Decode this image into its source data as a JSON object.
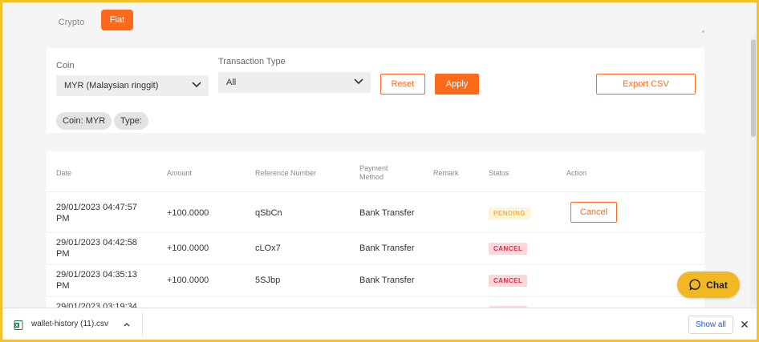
{
  "tabs": {
    "crypto": "Crypto",
    "fiat": "Fiat"
  },
  "filters": {
    "coin_label": "Coin",
    "coin_value": "MYR (Malaysian ringgit)",
    "type_label": "Transaction Type",
    "type_value": "All",
    "reset_label": "Reset",
    "apply_label": "Apply",
    "export_label": "Export CSV",
    "chip_coin": "Coin: MYR",
    "chip_type": "Type:"
  },
  "table": {
    "headers": {
      "date": "Date",
      "amount": "Amount",
      "reference": "Reference Number",
      "payment_1": "Payment",
      "payment_2": "Method",
      "remark": "Remark",
      "status": "Status",
      "action": "Action"
    },
    "rows": [
      {
        "date_1": "29/01/2023 04:47:57",
        "date_2": "PM",
        "amount": "+100.0000",
        "reference": "qSbCn",
        "method": "Bank Transfer",
        "status": "PENDING",
        "action": "Cancel"
      },
      {
        "date_1": "29/01/2023 04:42:58",
        "date_2": "PM",
        "amount": "+100.0000",
        "reference": "cLOx7",
        "method": "Bank Transfer",
        "status": "CANCEL"
      },
      {
        "date_1": "29/01/2023 04:35:13",
        "date_2": "PM",
        "amount": "+100.0000",
        "reference": "5SJbp",
        "method": "Bank Transfer",
        "status": "CANCEL"
      },
      {
        "date_1": "29/01/2023 03:19:34"
      }
    ]
  },
  "chat": {
    "label": "Chat",
    "icon": "chat-bubble-icon",
    "color": "#f2b824"
  },
  "download_bar": {
    "file_name": "wallet-history (11).csv",
    "file_icon": "excel-file-icon",
    "show_all": "Show all"
  },
  "colors": {
    "accent": "#ff6a1a",
    "pending": "#e8b54a",
    "cancel": "#d9304a",
    "frame": "#f2c12e"
  }
}
